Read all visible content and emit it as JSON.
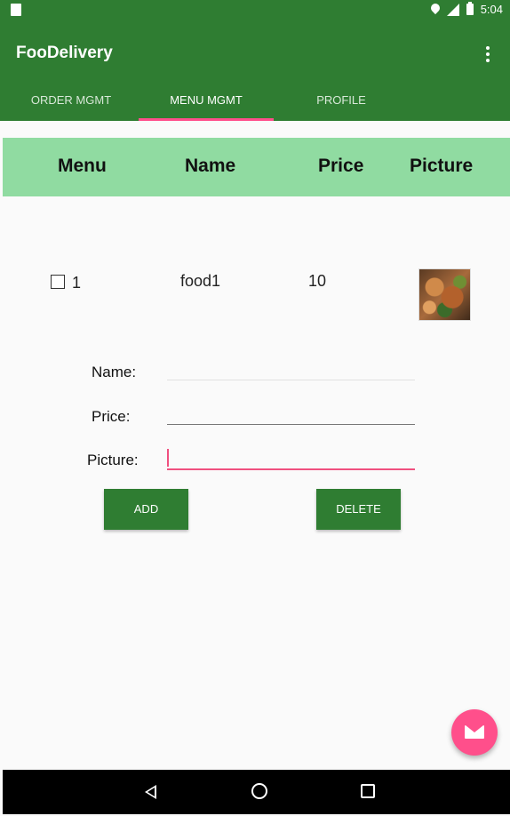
{
  "status_bar": {
    "time": "5:04"
  },
  "app_bar": {
    "title": "FooDelivery"
  },
  "tabs": [
    {
      "label": "ORDER MGMT",
      "active": false
    },
    {
      "label": "MENU MGMT",
      "active": true
    },
    {
      "label": "PROFILE",
      "active": false
    }
  ],
  "table": {
    "headers": [
      "Menu",
      "Name",
      "Price",
      "Picture"
    ],
    "rows": [
      {
        "menu": "1",
        "name": "food1",
        "price": "10",
        "checked": false
      }
    ]
  },
  "form": {
    "name_label": "Name:",
    "price_label": "Price:",
    "picture_label": "Picture:",
    "name_value": "",
    "price_value": "",
    "picture_value": ""
  },
  "buttons": {
    "add": "ADD",
    "delete": "DELETE"
  },
  "colors": {
    "primary": "#2f7d32",
    "header_row": "#90dba1",
    "accent": "#ff4f8b"
  }
}
